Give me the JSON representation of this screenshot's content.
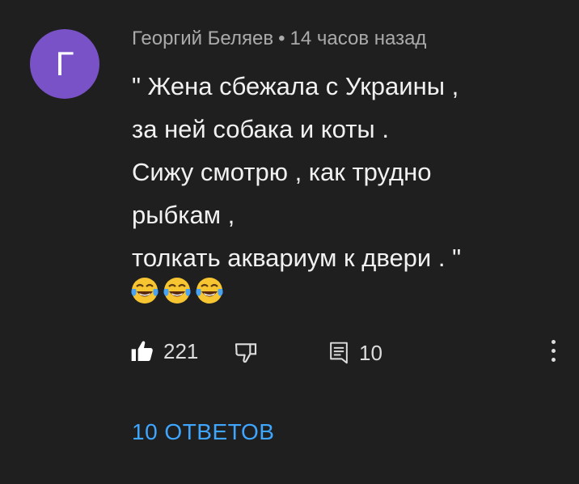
{
  "comment": {
    "avatar_letter": "Г",
    "avatar_color": "#7a52c7",
    "author": "Георгий Беляев",
    "separator": "•",
    "time": "14 часов назад",
    "lines": [
      "\" Жена сбежала с Украины ,",
      "за ней собака и коты .",
      "Сижу смотрю , как трудно",
      "рыбкам ,",
      "толкать аквариум к двери . \""
    ],
    "emojis": [
      "face-with-tears-of-joy-icon",
      "face-with-tears-of-joy-icon",
      "face-with-tears-of-joy-icon"
    ],
    "like_count": "221",
    "reply_count": "10",
    "replies_label": "10 ОТВЕТОВ",
    "link_color": "#3ea6ff"
  }
}
